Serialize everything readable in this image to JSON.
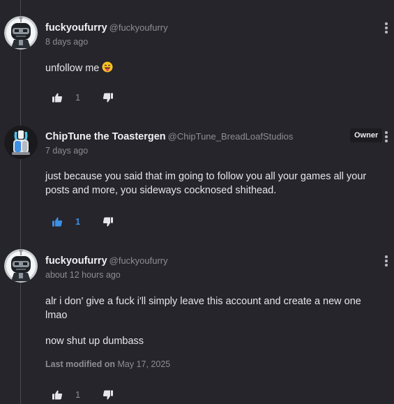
{
  "comments": [
    {
      "username": "fuckyoufurry",
      "handle": "@fuckyoufurry",
      "time": "8 days ago",
      "body": [
        "unfollow me"
      ],
      "emoji": "grinning-face-with-tongue",
      "likes": "1",
      "liked": false
    },
    {
      "username": "ChipTune the Toastergen",
      "handle": "@ChipTune_BreadLoafStudios",
      "badge": "Owner",
      "time": "7 days ago",
      "body": [
        "just because you said that im going to follow you all your games all your posts and more, you sideways cocknosed shithead."
      ],
      "likes": "1",
      "liked": true
    },
    {
      "username": "fuckyoufurry",
      "handle": "@fuckyoufurry",
      "time": "about 12 hours ago",
      "body": [
        "alr i don' give a fuck i'll simply leave this account and create a new one lmao",
        "now shut up dumbass"
      ],
      "modified_label": "Last modified on",
      "modified_date": "May 17, 2025",
      "likes": "1",
      "liked": false
    }
  ],
  "colors": {
    "background": "#26252b",
    "accent_blue": "#3d8fe6",
    "muted_text": "#8e8d94"
  }
}
